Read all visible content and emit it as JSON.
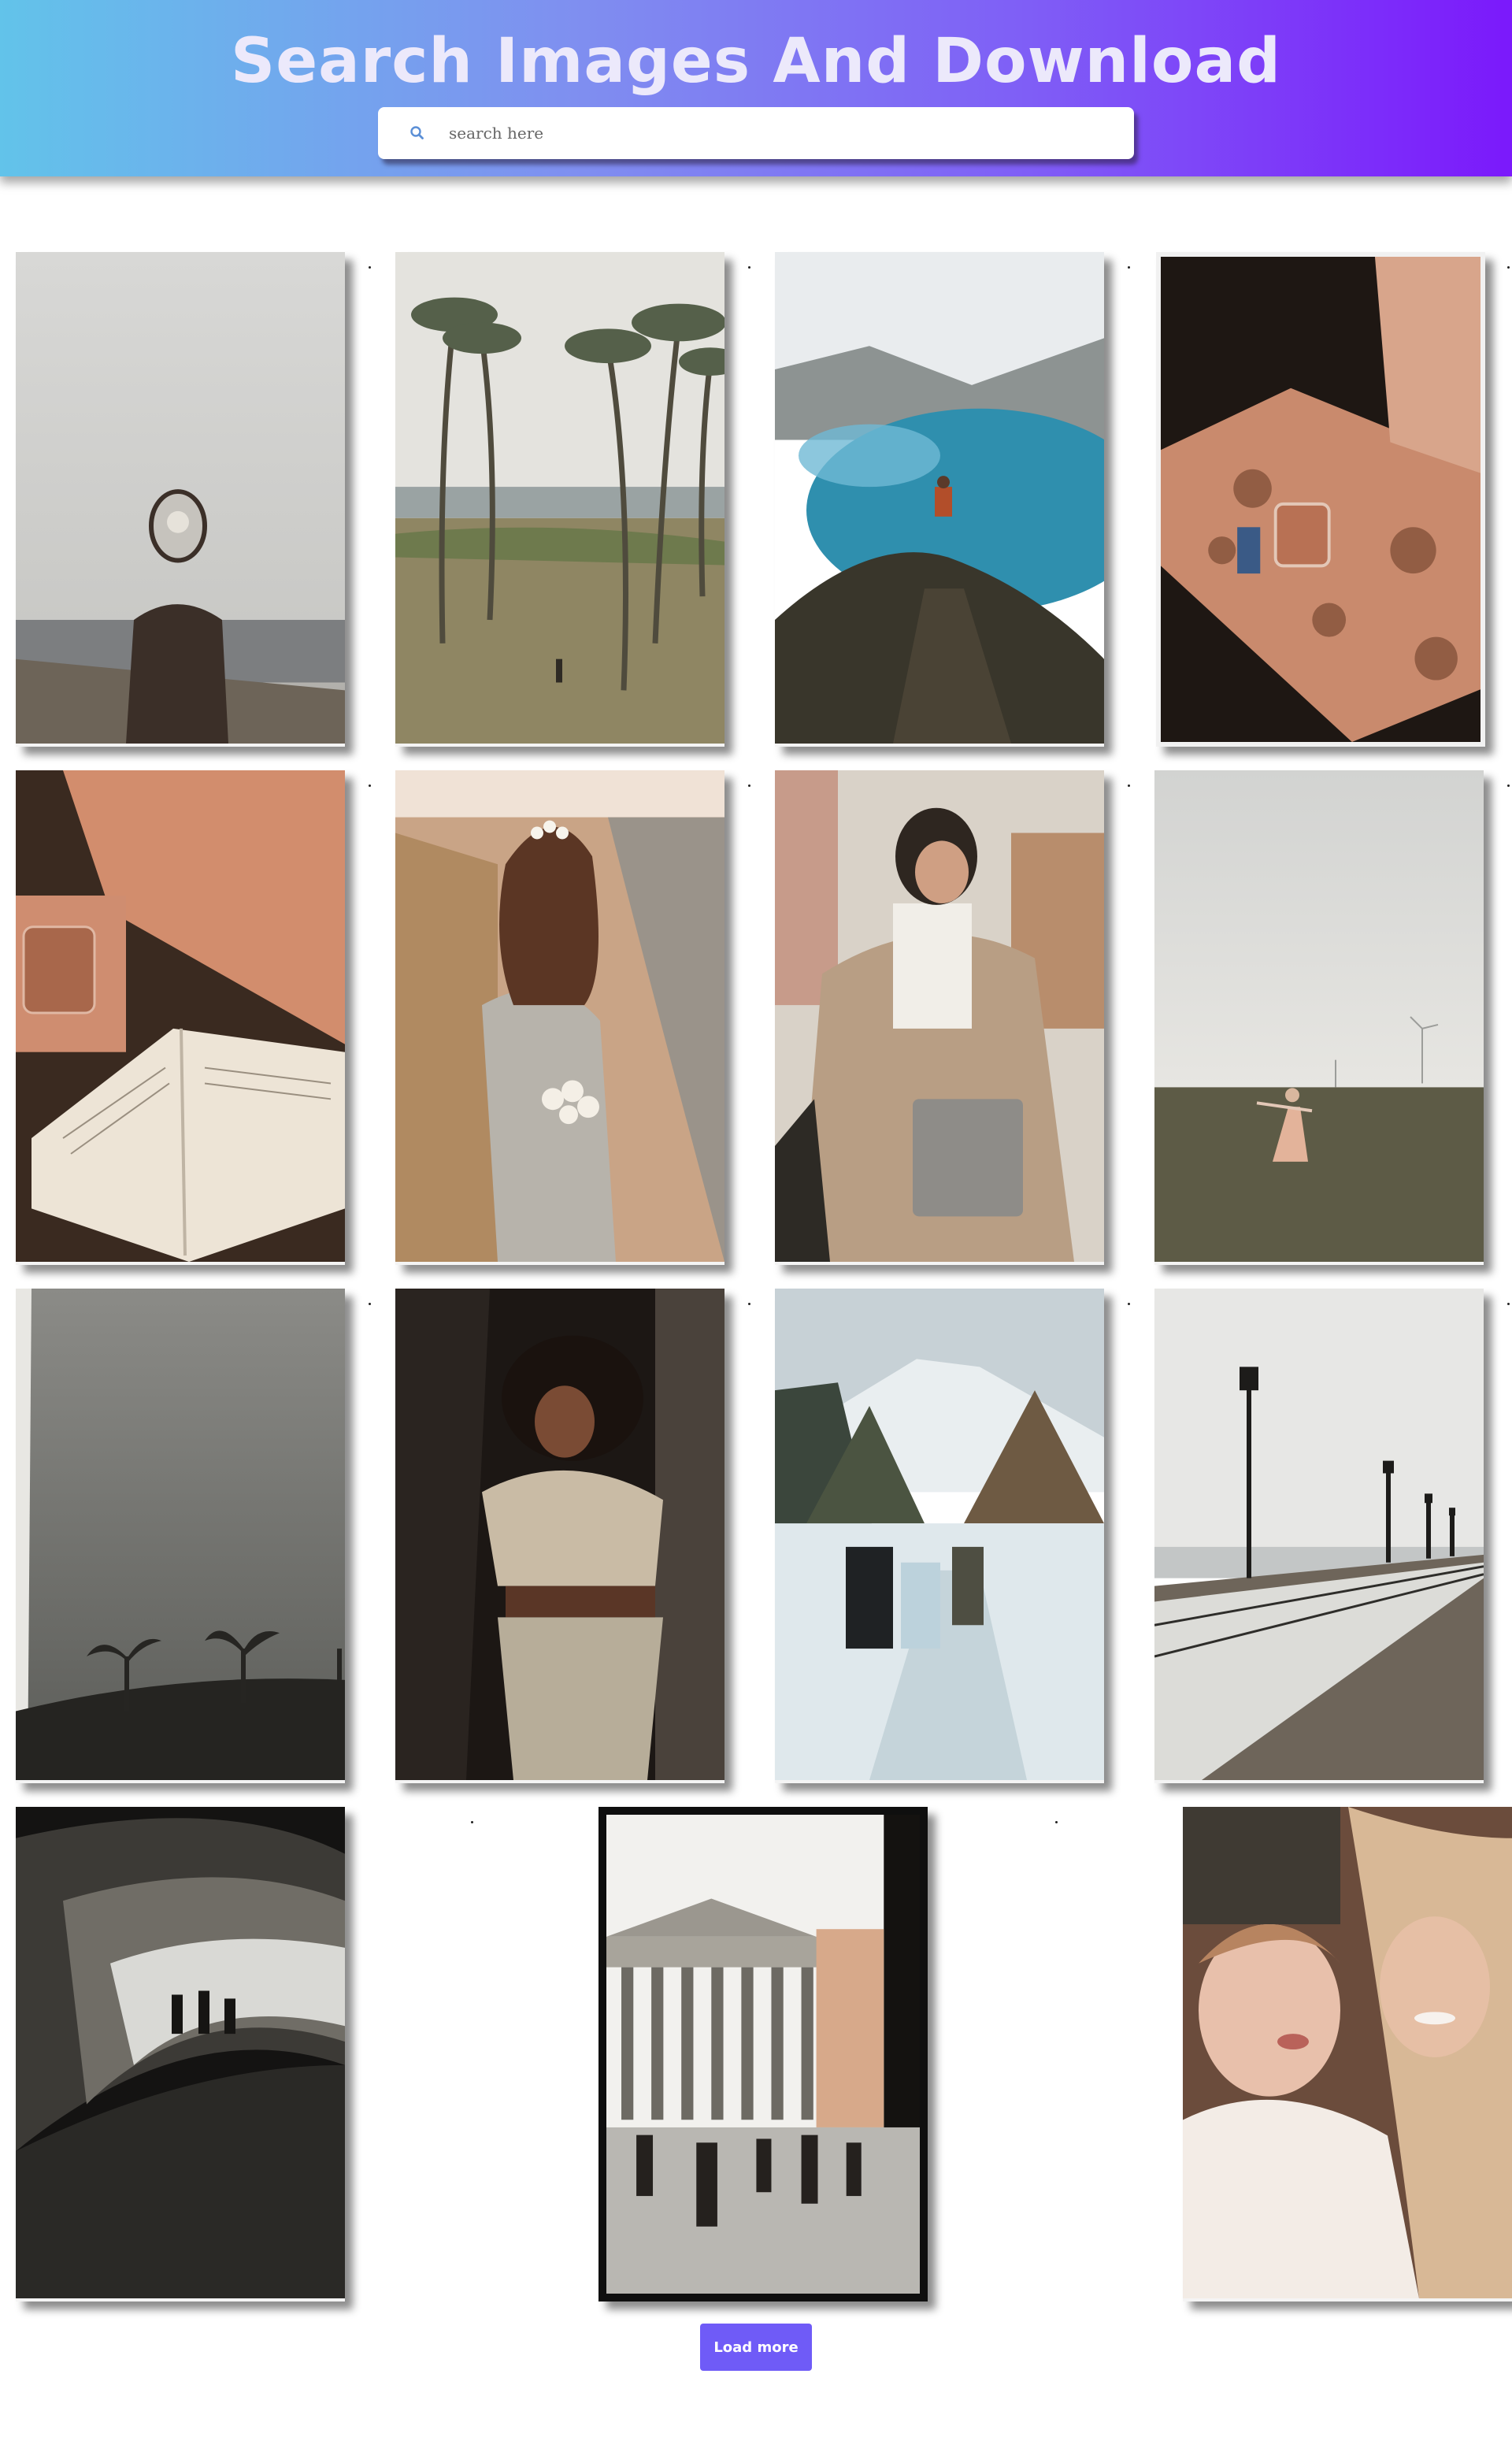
{
  "header": {
    "title": "Search Images And Download",
    "background_start": "#62c3ea",
    "background_end": "#7b19fb"
  },
  "search": {
    "icon": "search-icon",
    "placeholder": "search here",
    "value": ""
  },
  "gallery": {
    "photos": [
      {
        "subject": "woman holding mirror over face on hillside by the sea"
      },
      {
        "subject": "person walking among tall palm trees"
      },
      {
        "subject": "hiker standing on rocky peak above turquoise crater lake"
      },
      {
        "subject": "iced drink and can on patterned cushion in sunlight"
      },
      {
        "subject": "open book and glass on patterned cushion"
      },
      {
        "subject": "woman with flowers in hair holding daisy bouquet on a path"
      },
      {
        "subject": "woman in headphones and trench coat holding a laptop"
      },
      {
        "subject": "woman running in a green field with wind turbines"
      },
      {
        "subject": "silhouetted palm trees on a hill under grey sky"
      },
      {
        "subject": "woman with curly hair posing against a dark wall"
      },
      {
        "subject": "people walking in snow toward a mountain"
      },
      {
        "subject": "pier boardwalk with street lamps and benches"
      },
      {
        "subject": "people walking through a curved tunnel"
      },
      {
        "subject": "crowd in front of the Pantheon in Rome"
      },
      {
        "subject": "smiling woman holding a toddler"
      }
    ]
  },
  "load_more": {
    "label": "Load more",
    "color": "#6f5bf7"
  }
}
